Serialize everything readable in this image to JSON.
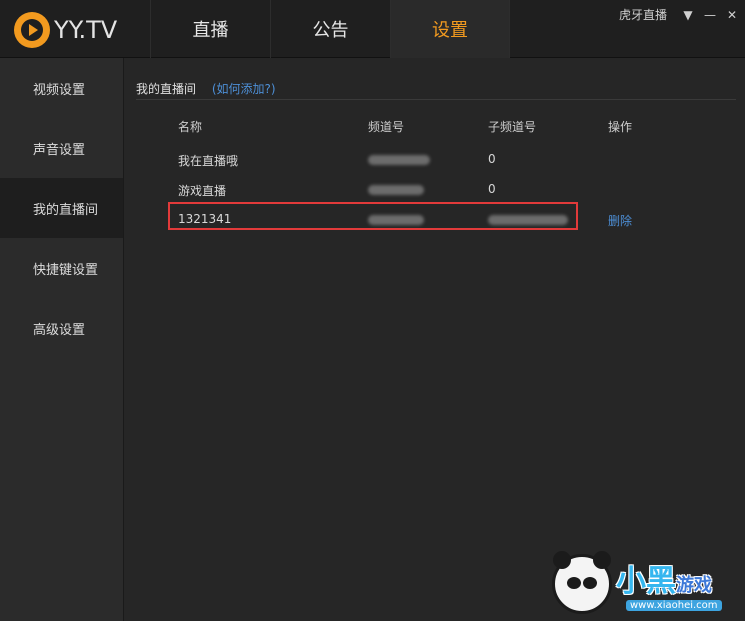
{
  "app": {
    "logo_text": "YY.TV",
    "brand_label": "虎牙直播"
  },
  "tabs": [
    {
      "label": "直播",
      "active": false
    },
    {
      "label": "公告",
      "active": false
    },
    {
      "label": "设置",
      "active": true
    }
  ],
  "window_controls": {
    "menu": "▼",
    "minimize": "—",
    "close": "✕"
  },
  "sidebar": {
    "items": [
      {
        "label": "视频设置",
        "active": false
      },
      {
        "label": "声音设置",
        "active": false
      },
      {
        "label": "我的直播间",
        "active": true
      },
      {
        "label": "快捷键设置",
        "active": false
      },
      {
        "label": "高级设置",
        "active": false
      }
    ]
  },
  "main": {
    "title": "我的直播间",
    "add_link": "(如何添加?)",
    "columns": [
      "名称",
      "频道号",
      "子频道号",
      "操作"
    ],
    "rows": [
      {
        "name": "我在直播哦",
        "channel": "",
        "subchannel": "0",
        "action": ""
      },
      {
        "name": "游戏直播",
        "channel": "",
        "subchannel": "0",
        "action": ""
      },
      {
        "name": "1321341",
        "channel": "",
        "subchannel": "",
        "action": "删除"
      }
    ]
  },
  "watermark": {
    "text_main": "小黑",
    "text_small": "游戏",
    "url": "www.xiaohei.com"
  },
  "colors": {
    "accent": "#f29a1f",
    "link": "#4d8fd6",
    "highlight_border": "#e23a3a"
  }
}
